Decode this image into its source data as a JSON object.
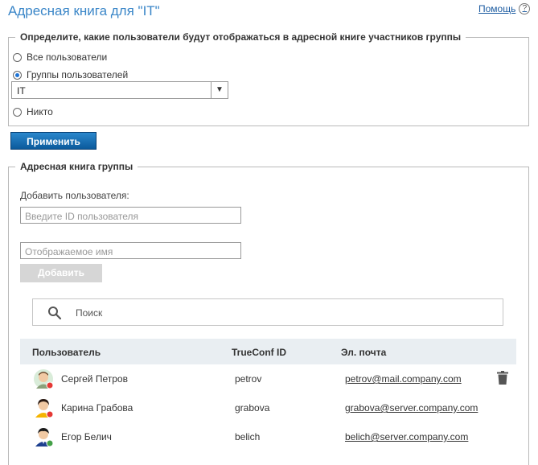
{
  "header": {
    "title": "Адресная книга для \"IT\"",
    "help_label": "Помощь",
    "help_icon": "?"
  },
  "visibility": {
    "legend": "Определите, какие пользователи будут отображаться в адресной книге участников группы",
    "options": [
      {
        "label": "Все пользователи",
        "checked": false
      },
      {
        "label": "Группы пользователей",
        "checked": true
      },
      {
        "label": "Никто",
        "checked": false
      }
    ],
    "group_select": {
      "value": "IT",
      "arrow": "▼"
    },
    "apply_label": "Применить"
  },
  "group_book": {
    "legend": "Адресная книга группы",
    "add_user_label": "Добавить пользователя:",
    "user_id_placeholder": "Введите ID пользователя",
    "display_name_placeholder": "Отображаемое имя",
    "add_button_label": "Добавить"
  },
  "search": {
    "placeholder": "Поиск"
  },
  "table": {
    "columns": [
      "Пользователь",
      "TrueConf ID",
      "Эл. почта"
    ],
    "rows": [
      {
        "name": "Сергей Петров",
        "id": "petrov",
        "email": "petrov@mail.company.com",
        "status_color": "#e53935"
      },
      {
        "name": "Карина Грабова",
        "id": "grabova",
        "email": "grabova@server.company.com",
        "status_color": "#e53935"
      },
      {
        "name": "Егор Белич",
        "id": "belich",
        "email": "belich@server.company.com",
        "status_color": "#43a047"
      }
    ]
  },
  "colors": {
    "title": "#3a86c8",
    "apply_button": "#0b5a9c",
    "header_bg": "#e9eef2"
  }
}
